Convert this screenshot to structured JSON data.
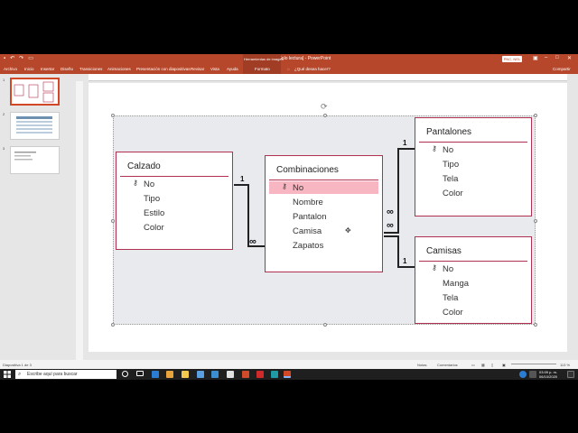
{
  "window": {
    "title": "Presentación1 [Solo lectura] - PowerPoint",
    "context_group": "Herramientas de imagen",
    "user": "PNC, NEL"
  },
  "ribbon": {
    "tabs": [
      "Archivo",
      "Inicio",
      "Insertar",
      "Diseño",
      "Transiciones",
      "Animaciones",
      "Presentación con diapositivas",
      "Revisar",
      "Vista",
      "Ayuda",
      "Formato"
    ],
    "tell_me": "¿Qué desea hacer?",
    "share": "Compartir"
  },
  "slides_pane": {
    "numbers": [
      "1",
      "2",
      "3"
    ]
  },
  "diagram": {
    "tables": [
      {
        "name": "Calzado",
        "fields": [
          "No",
          "Tipo",
          "Estilo",
          "Color"
        ]
      },
      {
        "name": "Combinaciones",
        "fields": [
          "No",
          "Nombre",
          "Pantalon",
          "Camisa",
          "Zapatos"
        ]
      },
      {
        "name": "Pantalones",
        "fields": [
          "No",
          "Tipo",
          "Tela",
          "Color"
        ]
      },
      {
        "name": "Camisas",
        "fields": [
          "No",
          "Manga",
          "Tela",
          "Color"
        ]
      }
    ],
    "labels": {
      "one": "1",
      "many": "∞"
    }
  },
  "status": {
    "slide": "Diapositiva 1 de 3",
    "notes": "Notas",
    "comments": "Comentarios",
    "zoom": "113 %"
  },
  "taskbar": {
    "search_placeholder": "Escribe aquí para buscar",
    "time": "03:09 p. m.",
    "date": "06/10/2020"
  },
  "colors": {
    "accent": "#b7472a",
    "table_border": "#b03050",
    "highlight": "#f7b6c2"
  }
}
